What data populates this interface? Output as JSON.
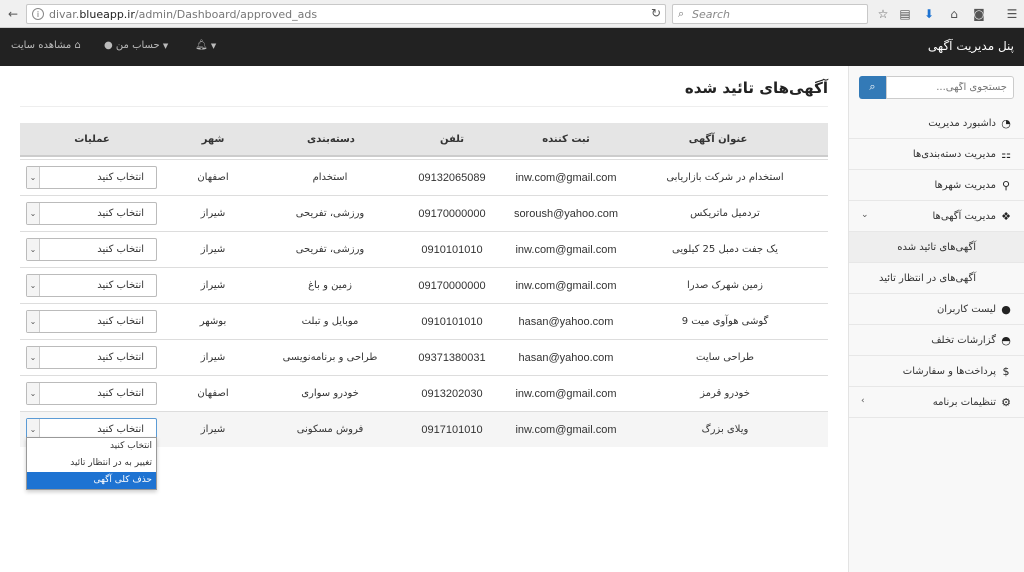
{
  "browser": {
    "url_prefix": "divar.",
    "url_host": "blueapp.ir",
    "url_path": "/admin/Dashboard/approved_ads",
    "search_placeholder": "Search"
  },
  "topnav": {
    "brand": "پنل مدیریت آگهی",
    "view_site": "مشاهده سایت",
    "my_account": "حساب من"
  },
  "sidebar": {
    "search_placeholder": "جستجوی آگهی...",
    "items": [
      {
        "label": "داشبورد مدیریت",
        "icon": "dashboard-icon"
      },
      {
        "label": "مدیریت دسته‌بندی‌ها",
        "icon": "sitemap-icon"
      },
      {
        "label": "مدیریت شهرها",
        "icon": "map-marker-icon"
      },
      {
        "label": "مدیریت آگهی‌ها",
        "icon": "cubes-icon"
      },
      {
        "label": "آگهی‌های تائید شده",
        "icon": ""
      },
      {
        "label": "آگهی‌های در انتظار تائید",
        "icon": ""
      },
      {
        "label": "لیست کاربران",
        "icon": "user-icon"
      },
      {
        "label": "گزارشات تخلف",
        "icon": "comment-icon"
      },
      {
        "label": "پرداخت‌ها و سفارشات",
        "icon": "dollar-icon"
      },
      {
        "label": "تنظیمات برنامه",
        "icon": "gear-icon"
      }
    ]
  },
  "page": {
    "title": "آگهی‌های تائید شده"
  },
  "table": {
    "headers": {
      "title": "عنوان آگهی",
      "submitter": "ثبت کننده",
      "phone": "تلفن",
      "category": "دسته‌بندی",
      "city": "شهر",
      "actions": "عملیات"
    },
    "select_placeholder": "انتخاب کنید",
    "rows": [
      {
        "title": "استخدام در شرکت بازاریابی",
        "submitter": "inw.com@gmail.com",
        "phone": "09132065089",
        "category": "استخدام",
        "city": "اصفهان"
      },
      {
        "title": "تردمیل ماتریکس",
        "submitter": "soroush@yahoo.com",
        "phone": "09170000000",
        "category": "ورزشی، تفریحی",
        "city": "شیراز"
      },
      {
        "title": "یک جفت دمبل 25 کیلویی",
        "submitter": "inw.com@gmail.com",
        "phone": "0910101010",
        "category": "ورزشی، تفریحی",
        "city": "شیراز"
      },
      {
        "title": "زمین شهرک صدرا",
        "submitter": "inw.com@gmail.com",
        "phone": "09170000000",
        "category": "زمین و باغ",
        "city": "شیراز"
      },
      {
        "title": "گوشی هوآوی میت 9",
        "submitter": "hasan@yahoo.com",
        "phone": "0910101010",
        "category": "موبایل و تبلت",
        "city": "بوشهر"
      },
      {
        "title": "طراحی سایت",
        "submitter": "hasan@yahoo.com",
        "phone": "09371380031",
        "category": "طراحی و برنامه‌نویسی",
        "city": "شیراز"
      },
      {
        "title": "خودرو قرمز",
        "submitter": "inw.com@gmail.com",
        "phone": "0913202030",
        "category": "خودرو سواری",
        "city": "اصفهان"
      },
      {
        "title": "ویلای بزرگ",
        "submitter": "inw.com@gmail.com",
        "phone": "0917101010",
        "category": "فروش مسکونی",
        "city": "شیراز"
      }
    ]
  },
  "dropdown": {
    "options": [
      "انتخاب کنید",
      "تغییر به در انتظار تائید",
      "حذف کلی آگهی"
    ],
    "highlighted_index": 2
  },
  "colors": {
    "accent": "#337ab7",
    "topbar": "#222222",
    "highlight": "#1e73d2"
  }
}
